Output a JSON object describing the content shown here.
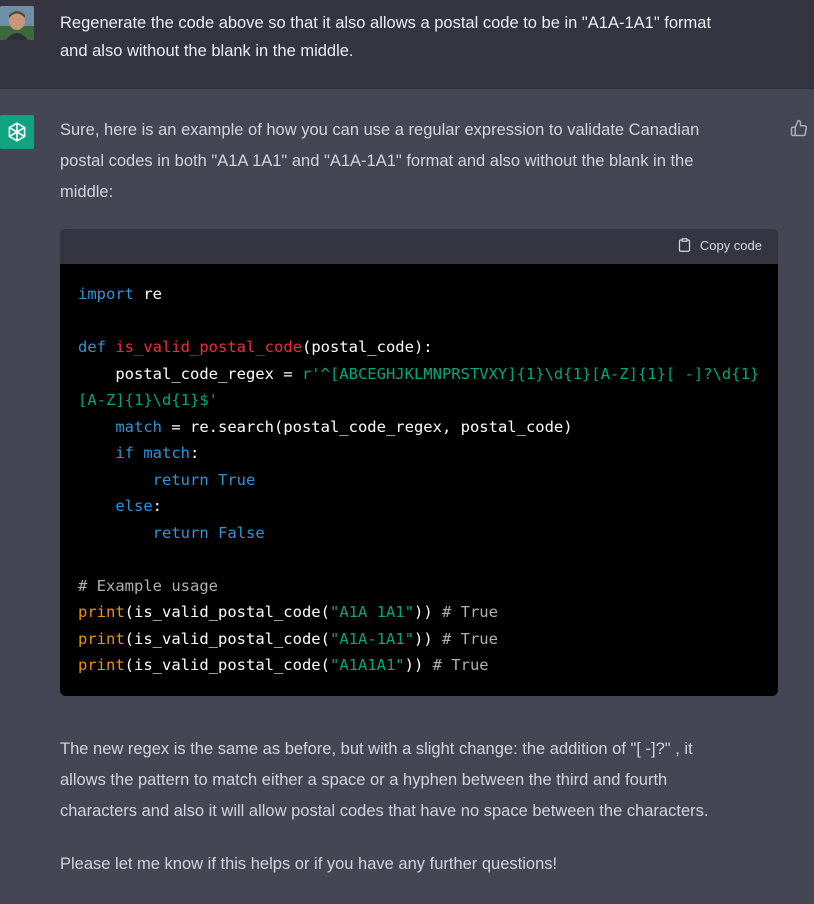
{
  "user": {
    "message_line1": "Regenerate the code above so that it also allows a postal code to be in \"A1A-1A1\" format",
    "message_line2": "and also without the blank in the middle."
  },
  "assistant": {
    "intro_line1": "Sure, here is an example of how you can use a regular expression to validate Canadian",
    "intro_line2": "postal codes in both \"A1A 1A1\" and \"A1A-1A1\" format and also without the blank in the",
    "intro_line3": "middle:",
    "copy_label": "Copy code",
    "code": {
      "l1_import": "import",
      "l1_mod": " re",
      "l3_def": "def",
      "l3_fn": "is_valid_postal_code",
      "l3_rest": "(postal_code):",
      "l4_var": "    postal_code_regex = ",
      "l4_str": "r'^[ABCEGHJKLMNPRSTVXY]{1}\\d{1}[A-Z]{1}[ -]?\\d{1}",
      "l5_str": "[A-Z]{1}\\d{1}$'",
      "l6_indent": "    ",
      "l6_kw": "match",
      "l6_rest": " = re.search(postal_code_regex, postal_code)",
      "l7_indent": "    ",
      "l7_if": "if",
      "l7_match": " match",
      "l7_colon": ":",
      "l8_indent": "        ",
      "l8_return": "return",
      "l8_true": " True",
      "l9_indent": "    ",
      "l9_else": "else",
      "l9_colon": ":",
      "l10_indent": "        ",
      "l10_return": "return",
      "l10_false": " False",
      "l12_comment": "# Example usage",
      "print": "print",
      "call_open": "(is_valid_postal_code(",
      "arg1": "\"A1A 1A1\"",
      "arg2": "\"A1A-1A1\"",
      "arg3": "\"A1A1A1\"",
      "call_close": ")) ",
      "comment_true": "# True"
    },
    "explain_line1": "The new regex is the same as before, but with a slight change: the addition of \"[ -]?\" , it",
    "explain_line2": "allows the pattern to match either a space or a hyphen between the third and fourth",
    "explain_line3": "characters and also it will allow postal codes that have no space between the characters.",
    "closing": "Please let me know if this helps or if you have any further questions!"
  },
  "colors": {
    "user_bg": "#343541",
    "assistant_bg": "#444654",
    "brand_green": "#10a37f",
    "code_keyword": "#2e95d3",
    "code_function": "#f22c3d",
    "code_string": "#00a67d",
    "code_builtin": "#e9950c"
  },
  "icons": [
    "user-avatar",
    "openai-logo-icon",
    "thumbs-up-icon",
    "clipboard-icon"
  ]
}
